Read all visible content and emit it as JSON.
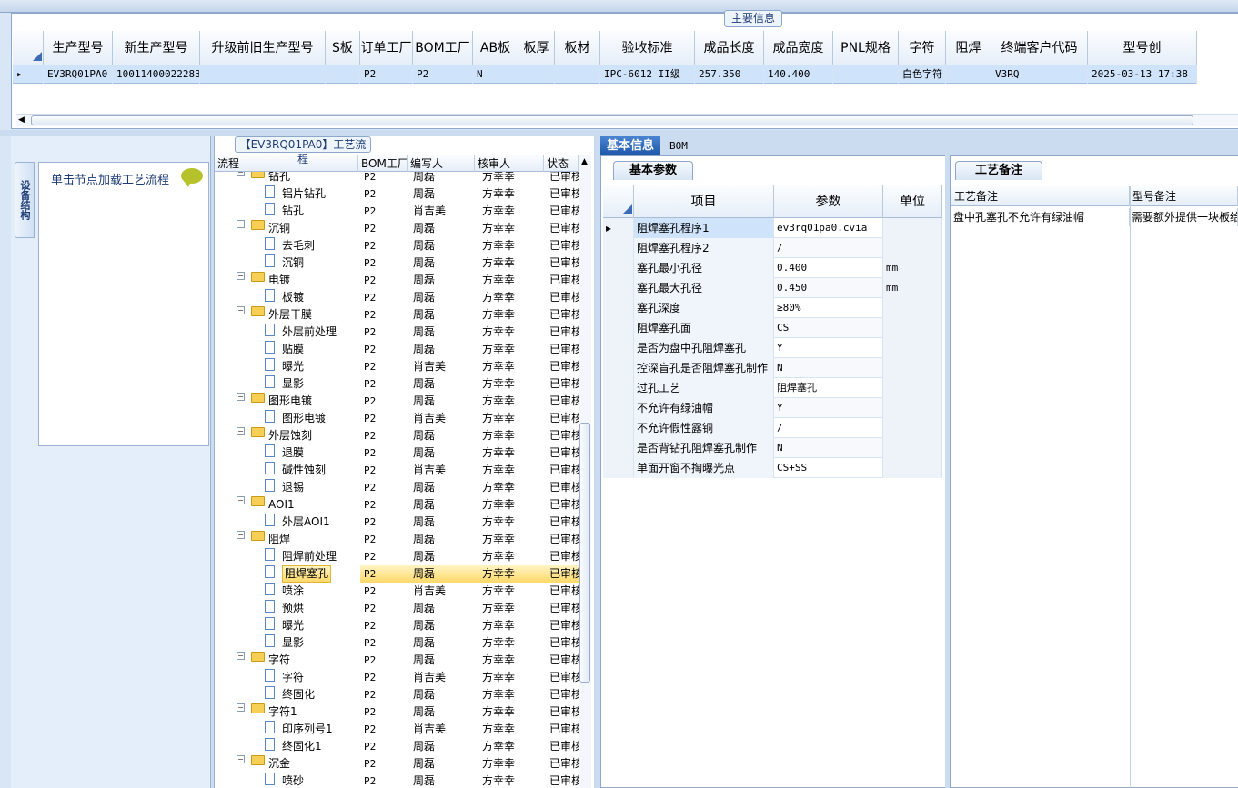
{
  "main_info": {
    "tab_label": "主要信息",
    "columns": [
      "生产型号",
      "新生产型号",
      "升级前旧生产型号",
      "S板",
      "订单工厂",
      "BOM工厂",
      "AB板",
      "板厚",
      "板材",
      "验收标准",
      "成品长度",
      "成品宽度",
      "PNL规格",
      "字符",
      "阻焊",
      "终端客户代码",
      "型号创"
    ],
    "row": [
      "EV3RQ01PA0",
      "10011400022283",
      "",
      "",
      "P2",
      "P2",
      "N",
      "",
      "",
      "IPC-6012 II级",
      "257.350",
      "140.400",
      "",
      "白色字符",
      "",
      "V3RQ",
      "2025-03-13 17:38"
    ]
  },
  "left_nav": {
    "vertical_tab": "设备结构",
    "label": "单击节点加载工艺流程",
    "icon": "chat-bubble-icon"
  },
  "tree": {
    "title": "【EV3RQ01PA0】工艺流程",
    "columns": [
      "流程",
      "BOM工厂",
      "编写人",
      "核审人",
      "状态"
    ],
    "rows": [
      {
        "name": "钻孔",
        "type": "folder",
        "bom": "P2",
        "writer": "周磊",
        "reviewer": "方幸幸",
        "status": "已审核"
      },
      {
        "name": "铝片钻孔",
        "type": "doc",
        "bom": "P2",
        "writer": "周磊",
        "reviewer": "方幸幸",
        "status": "已审核"
      },
      {
        "name": "钻孔",
        "type": "doc",
        "bom": "P2",
        "writer": "肖吉美",
        "reviewer": "方幸幸",
        "status": "已审核"
      },
      {
        "name": "沉铜",
        "type": "folder",
        "bom": "P2",
        "writer": "周磊",
        "reviewer": "方幸幸",
        "status": "已审核"
      },
      {
        "name": "去毛刺",
        "type": "doc",
        "bom": "P2",
        "writer": "周磊",
        "reviewer": "方幸幸",
        "status": "已审核"
      },
      {
        "name": "沉铜",
        "type": "doc",
        "bom": "P2",
        "writer": "周磊",
        "reviewer": "方幸幸",
        "status": "已审核"
      },
      {
        "name": "电镀",
        "type": "folder",
        "bom": "P2",
        "writer": "周磊",
        "reviewer": "方幸幸",
        "status": "已审核"
      },
      {
        "name": "板镀",
        "type": "doc",
        "bom": "P2",
        "writer": "周磊",
        "reviewer": "方幸幸",
        "status": "已审核"
      },
      {
        "name": "外层干膜",
        "type": "folder",
        "bom": "P2",
        "writer": "周磊",
        "reviewer": "方幸幸",
        "status": "已审核"
      },
      {
        "name": "外层前处理",
        "type": "doc",
        "bom": "P2",
        "writer": "周磊",
        "reviewer": "方幸幸",
        "status": "已审核"
      },
      {
        "name": "贴膜",
        "type": "doc",
        "bom": "P2",
        "writer": "周磊",
        "reviewer": "方幸幸",
        "status": "已审核"
      },
      {
        "name": "曝光",
        "type": "doc",
        "bom": "P2",
        "writer": "肖吉美",
        "reviewer": "方幸幸",
        "status": "已审核"
      },
      {
        "name": "显影",
        "type": "doc",
        "bom": "P2",
        "writer": "周磊",
        "reviewer": "方幸幸",
        "status": "已审核"
      },
      {
        "name": "图形电镀",
        "type": "folder",
        "bom": "P2",
        "writer": "周磊",
        "reviewer": "方幸幸",
        "status": "已审核"
      },
      {
        "name": "图形电镀",
        "type": "doc",
        "bom": "P2",
        "writer": "肖吉美",
        "reviewer": "方幸幸",
        "status": "已审核"
      },
      {
        "name": "外层蚀刻",
        "type": "folder",
        "bom": "P2",
        "writer": "周磊",
        "reviewer": "方幸幸",
        "status": "已审核"
      },
      {
        "name": "退膜",
        "type": "doc",
        "bom": "P2",
        "writer": "周磊",
        "reviewer": "方幸幸",
        "status": "已审核"
      },
      {
        "name": "碱性蚀刻",
        "type": "doc",
        "bom": "P2",
        "writer": "肖吉美",
        "reviewer": "方幸幸",
        "status": "已审核"
      },
      {
        "name": "退锡",
        "type": "doc",
        "bom": "P2",
        "writer": "周磊",
        "reviewer": "方幸幸",
        "status": "已审核"
      },
      {
        "name": "AOI1",
        "type": "folder",
        "bom": "P2",
        "writer": "周磊",
        "reviewer": "方幸幸",
        "status": "已审核"
      },
      {
        "name": "外层AOI1",
        "type": "doc",
        "bom": "P2",
        "writer": "周磊",
        "reviewer": "方幸幸",
        "status": "已审核"
      },
      {
        "name": "阻焊",
        "type": "folder",
        "bom": "P2",
        "writer": "周磊",
        "reviewer": "方幸幸",
        "status": "已审核"
      },
      {
        "name": "阻焊前处理",
        "type": "doc",
        "bom": "P2",
        "writer": "周磊",
        "reviewer": "方幸幸",
        "status": "已审核"
      },
      {
        "name": "阻焊塞孔",
        "type": "doc",
        "bom": "P2",
        "writer": "周磊",
        "reviewer": "方幸幸",
        "status": "已审核",
        "selected": true
      },
      {
        "name": "喷涂",
        "type": "doc",
        "bom": "P2",
        "writer": "肖吉美",
        "reviewer": "方幸幸",
        "status": "已审核"
      },
      {
        "name": "预烘",
        "type": "doc",
        "bom": "P2",
        "writer": "周磊",
        "reviewer": "方幸幸",
        "status": "已审核"
      },
      {
        "name": "曝光",
        "type": "doc",
        "bom": "P2",
        "writer": "周磊",
        "reviewer": "方幸幸",
        "status": "已审核"
      },
      {
        "name": "显影",
        "type": "doc",
        "bom": "P2",
        "writer": "周磊",
        "reviewer": "方幸幸",
        "status": "已审核"
      },
      {
        "name": "字符",
        "type": "folder",
        "bom": "P2",
        "writer": "周磊",
        "reviewer": "方幸幸",
        "status": "已审核"
      },
      {
        "name": "字符",
        "type": "doc",
        "bom": "P2",
        "writer": "肖吉美",
        "reviewer": "方幸幸",
        "status": "已审核"
      },
      {
        "name": "终固化",
        "type": "doc",
        "bom": "P2",
        "writer": "周磊",
        "reviewer": "方幸幸",
        "status": "已审核"
      },
      {
        "name": "字符1",
        "type": "folder",
        "bom": "P2",
        "writer": "周磊",
        "reviewer": "方幸幸",
        "status": "已审核"
      },
      {
        "name": "印序列号1",
        "type": "doc",
        "bom": "P2",
        "writer": "肖吉美",
        "reviewer": "方幸幸",
        "status": "已审核"
      },
      {
        "name": "终固化1",
        "type": "doc",
        "bom": "P2",
        "writer": "周磊",
        "reviewer": "方幸幸",
        "status": "已审核"
      },
      {
        "name": "沉金",
        "type": "folder",
        "bom": "P2",
        "writer": "周磊",
        "reviewer": "方幸幸",
        "status": "已审核"
      },
      {
        "name": "喷砂",
        "type": "doc",
        "bom": "P2",
        "writer": "周磊",
        "reviewer": "方幸幸",
        "status": "已审核"
      }
    ]
  },
  "info_tabs": {
    "basic": "基本信息",
    "bom": "BOM"
  },
  "params": {
    "tab_label": "基本参数",
    "columns": [
      "项目",
      "参数",
      "单位"
    ],
    "rows": [
      {
        "item": "阻焊塞孔程序1",
        "value": "ev3rq01pa0.cvia",
        "unit": ""
      },
      {
        "item": "阻焊塞孔程序2",
        "value": "/",
        "unit": ""
      },
      {
        "item": "塞孔最小孔径",
        "value": "0.400",
        "unit": "mm"
      },
      {
        "item": "塞孔最大孔径",
        "value": "0.450",
        "unit": "mm"
      },
      {
        "item": "塞孔深度",
        "value": "≥80%",
        "unit": ""
      },
      {
        "item": "阻焊塞孔面",
        "value": "CS",
        "unit": ""
      },
      {
        "item": "是否为盘中孔阻焊塞孔",
        "value": "Y",
        "unit": ""
      },
      {
        "item": "控深盲孔是否阻焊塞孔制作",
        "value": "N",
        "unit": ""
      },
      {
        "item": "过孔工艺",
        "value": "阻焊塞孔",
        "unit": ""
      },
      {
        "item": "不允许有绿油帽",
        "value": "Y",
        "unit": ""
      },
      {
        "item": "不允许假性露铜",
        "value": "/",
        "unit": ""
      },
      {
        "item": "是否背钻孔阻焊塞孔制作",
        "value": "N",
        "unit": ""
      },
      {
        "item": "单面开窗不掏曝光点",
        "value": "CS+SS",
        "unit": ""
      }
    ]
  },
  "remarks": {
    "tab_label": "工艺备注",
    "columns": [
      "工艺备注",
      "型号备注"
    ],
    "row": [
      "盘中孔塞孔不允许有绿油帽",
      "需要额外提供一块板给"
    ]
  }
}
